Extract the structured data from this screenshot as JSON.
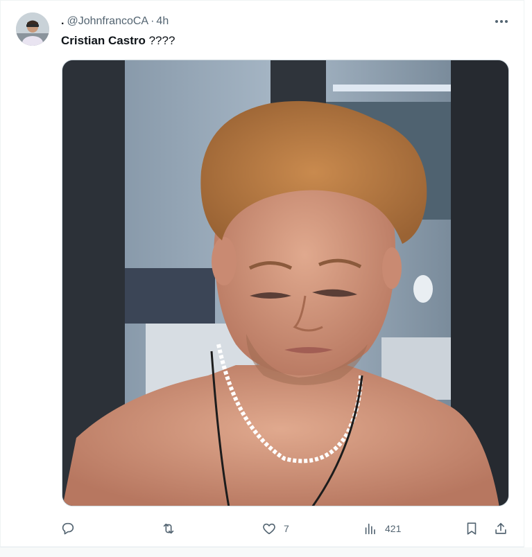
{
  "tweet": {
    "display_name": ".",
    "handle": "@JohnfrancoCA",
    "separator": "·",
    "time": "4h",
    "text_bold": "Cristian Castro",
    "text_rest": " ????"
  },
  "actions": {
    "reply_count": "",
    "retweet_count": "",
    "like_count": "7",
    "views_count": "421"
  },
  "icons": {
    "more": "more-horizontal-icon",
    "reply": "reply-icon",
    "retweet": "retweet-icon",
    "like": "heart-icon",
    "views": "views-icon",
    "bookmark": "bookmark-icon",
    "share": "share-icon"
  },
  "colors": {
    "text_primary": "#0f1419",
    "text_secondary": "#536471",
    "border": "#cfd9de"
  }
}
